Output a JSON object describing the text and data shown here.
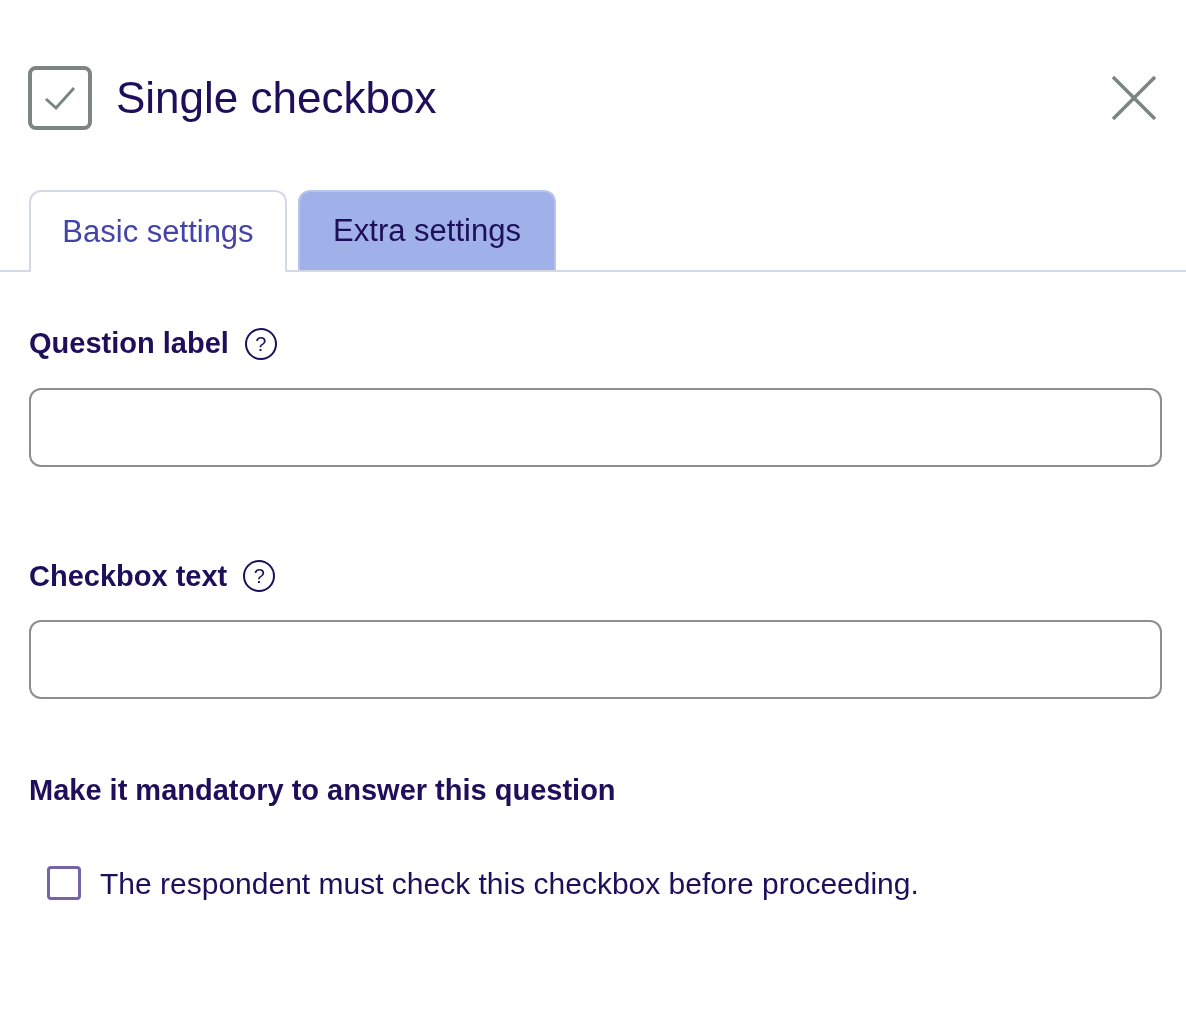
{
  "dialog": {
    "title": "Single checkbox"
  },
  "tabs": [
    {
      "label": "Basic settings",
      "selected": true
    },
    {
      "label": "Extra settings",
      "selected": false
    }
  ],
  "fields": [
    {
      "label": "Question label",
      "help": "?"
    },
    {
      "label": "Checkbox text",
      "help": "?"
    }
  ],
  "mandatory": {
    "heading": "Make it mandatory to answer this question",
    "option": {
      "label": "The respondent must check this checkbox before proceeding.",
      "checked": false
    }
  }
}
